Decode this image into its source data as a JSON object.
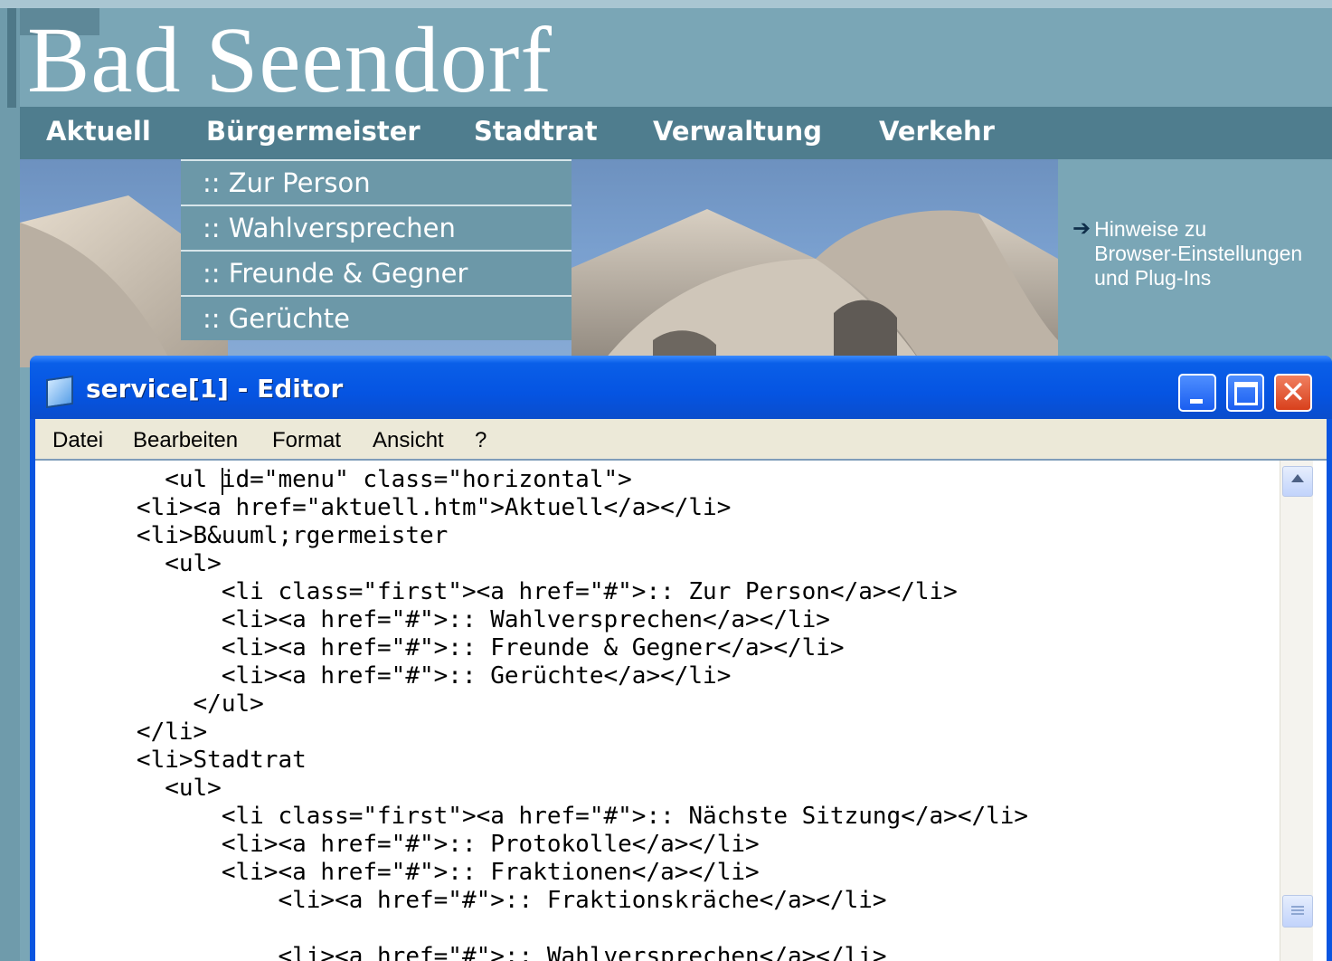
{
  "site": {
    "title": "Bad Seendorf",
    "nav": [
      "Aktuell",
      "Bürgermeister",
      "Stadtrat",
      "Verwaltung",
      "Verkehr"
    ],
    "submenu": [
      ":: Zur Person",
      ":: Wahlversprechen",
      ":: Freunde & Gegner",
      ":: Gerüchte"
    ],
    "hint": [
      "Hinweise zu",
      "Browser-Einstellungen",
      "und Plug-Ins"
    ]
  },
  "editor": {
    "title": "service[1] - Editor",
    "menu": [
      "Datei",
      "Bearbeiten",
      "Format",
      "Ansicht",
      "?"
    ],
    "code": [
      "        <ul id=\"menu\" class=\"horizontal\">",
      "      <li><a href=\"aktuell.htm\">Aktuell</a></li>",
      "      <li>B&uuml;rgermeister",
      "        <ul>",
      "            <li class=\"first\"><a href=\"#\">:: Zur Person</a></li>",
      "            <li><a href=\"#\">:: Wahlversprechen</a></li>",
      "            <li><a href=\"#\">:: Freunde & Gegner</a></li>",
      "            <li><a href=\"#\">:: Gerüchte</a></li>",
      "          </ul>",
      "      </li>",
      "      <li>Stadtrat",
      "        <ul>",
      "            <li class=\"first\"><a href=\"#\">:: Nächste Sitzung</a></li>",
      "            <li><a href=\"#\">:: Protokolle</a></li>",
      "            <li><a href=\"#\">:: Fraktionen</a></li>",
      "                <li><a href=\"#\">:: Fraktionskräche</a></li>",
      "",
      "                <li><a href=\"#\">:: Wahlversprechen</a></li>"
    ]
  },
  "colors": {
    "navbar": "#4f7d8e",
    "dropdown": "#6c98a8",
    "xp_titlebar": "#0554e2",
    "menubar": "#ece9d8"
  }
}
